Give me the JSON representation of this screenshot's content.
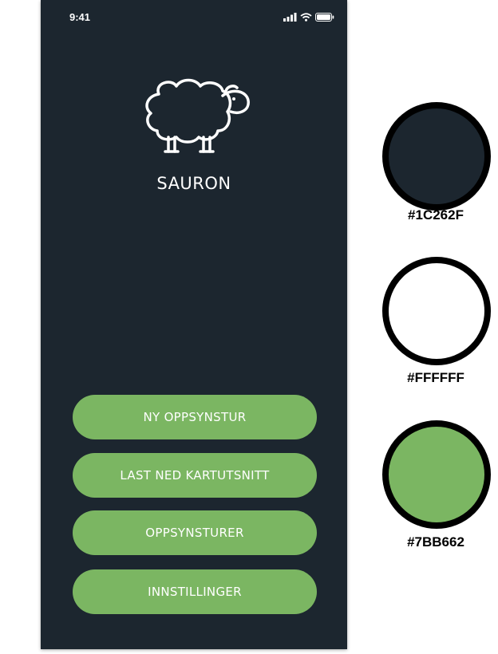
{
  "status_bar": {
    "time": "9:41",
    "icons": [
      "cellular-signal-icon",
      "wifi-icon",
      "battery-icon"
    ]
  },
  "app": {
    "logo_icon": "sheep-icon",
    "title": "SAURON"
  },
  "menu": {
    "new_trip": "NY OPPSYNSTUR",
    "download_map": "LAST NED KARTUTSNITT",
    "trips": "OPPSYNSTURER",
    "settings": "INNSTILLINGER"
  },
  "palette": [
    {
      "hex": "#1C262F",
      "label": "#1C262F"
    },
    {
      "hex": "#FFFFFF",
      "label": "#FFFFFF"
    },
    {
      "hex": "#7BB662",
      "label": "#7BB662"
    }
  ]
}
